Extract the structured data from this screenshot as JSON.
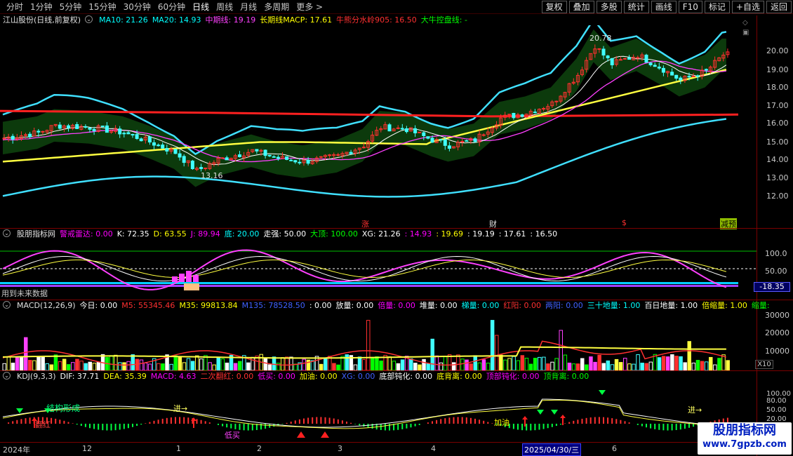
{
  "toolbar": {
    "periods": [
      "分时",
      "1分钟",
      "5分钟",
      "15分钟",
      "30分钟",
      "60分钟",
      "日线",
      "周线",
      "月线",
      "多周期",
      "更多 >"
    ],
    "right_buttons": [
      "复权",
      "叠加",
      "多股",
      "统计",
      "画线",
      "F10",
      "标记",
      "+自选",
      "返回"
    ]
  },
  "main": {
    "title": "江山股份(日线,前复权)",
    "ma10": "MA10: 21.26",
    "ma20": "MA20: 14.93",
    "mid": "中期线: 19.19",
    "long": "长期线MACP: 17.61",
    "bear": "牛熊分水岭905: 16.50",
    "bull": "大牛控盘线: -",
    "high_label": "20.78",
    "low_label": "13.16",
    "y_ticks": [
      "20.00",
      "19.00",
      "18.00",
      "17.00",
      "16.00",
      "15.00",
      "14.00",
      "13.00",
      "12.00"
    ],
    "markers": [
      "涨",
      "财",
      "$",
      "减预"
    ]
  },
  "ind1": {
    "title": "股朋指标网",
    "items": [
      {
        "t": "警戒雷达: 0.00",
        "c": "#ff00ff"
      },
      {
        "t": "K: 72.35",
        "c": "#ffffff"
      },
      {
        "t": "D: 63.55",
        "c": "#ffff00"
      },
      {
        "t": "J: 89.94",
        "c": "#ff00ff"
      },
      {
        "t": "底: 20.00",
        "c": "#00ffff"
      },
      {
        "t": "走强: 50.00",
        "c": "#ffffff"
      },
      {
        "t": "大顶: 100.00",
        "c": "#00ff00"
      },
      {
        "t": "XG: 21.26",
        "c": "#ffffff"
      },
      {
        "t": ": 14.93",
        "c": "#ff00ff"
      },
      {
        "t": ": 19.69",
        "c": "#ffff00"
      },
      {
        "t": ": 19.19",
        "c": "#ffffff"
      },
      {
        "t": ": 17.61",
        "c": "#ffffff"
      },
      {
        "t": ": 16.50",
        "c": "#ffffff"
      }
    ],
    "note": "用到未来数据",
    "y_ticks": [
      "100.0",
      "50.00"
    ],
    "value_box": "-18.35"
  },
  "ind2": {
    "title": "MACD(12,26,9)",
    "items": [
      {
        "t": "今日: 0.00",
        "c": "#ffffff"
      },
      {
        "t": "M5: 55345.46",
        "c": "#ff3030"
      },
      {
        "t": "M35: 99813.84",
        "c": "#ffff00"
      },
      {
        "t": "M135: 78528.50",
        "c": "#4060ff"
      },
      {
        "t": ": 0.00",
        "c": "#ffffff"
      },
      {
        "t": "放量: 0.00",
        "c": "#ffffff"
      },
      {
        "t": "倍量: 0.00",
        "c": "#ff00ff"
      },
      {
        "t": "堆量: 0.00",
        "c": "#ffffff"
      },
      {
        "t": "梯量: 0.00",
        "c": "#00ffff"
      },
      {
        "t": "红阳: 0.00",
        "c": "#ff3030"
      },
      {
        "t": "两阳: 0.00",
        "c": "#4060ff"
      },
      {
        "t": "三十地量: 1.00",
        "c": "#00ffff"
      },
      {
        "t": "百日地量: 1.00",
        "c": "#ffffff"
      },
      {
        "t": "倍缩量: 1.00",
        "c": "#ffff00"
      },
      {
        "t": "缩量:",
        "c": "#00ff00"
      }
    ],
    "y_ticks": [
      "30000",
      "20000",
      "10000"
    ],
    "unit": "X10"
  },
  "ind3": {
    "title": "KDJ(9,3,3)",
    "items": [
      {
        "t": "DIF: 37.71",
        "c": "#ffffff"
      },
      {
        "t": "DEA: 35.39",
        "c": "#ffff00"
      },
      {
        "t": "MACD: 4.63",
        "c": "#ff00ff"
      },
      {
        "t": "二次翻红: 0.00",
        "c": "#ff3030"
      },
      {
        "t": "低买: 0.00",
        "c": "#ff00ff"
      },
      {
        "t": "加油: 0.00",
        "c": "#ffff00"
      },
      {
        "t": "XG: 0.00",
        "c": "#4060ff"
      },
      {
        "t": "底部钝化: 0.00",
        "c": "#ffffff"
      },
      {
        "t": "底背离: 0.00",
        "c": "#ffff00"
      },
      {
        "t": "顶部钝化: 0.00",
        "c": "#ff00ff"
      },
      {
        "t": "顶背离: 0.00",
        "c": "#00ff00"
      }
    ],
    "y_ticks": [
      "100.00",
      "80.00",
      "50.00",
      "20.00",
      "0.00"
    ],
    "labels": {
      "jgxc": "结构形成",
      "jin1": "进→",
      "jin2": "进→",
      "fan": "翻红",
      "dimai": "低买",
      "jiayou": "加油"
    }
  },
  "xaxis": {
    "labels": [
      "2024年",
      "12",
      "1",
      "2",
      "3",
      "4",
      "2025/04/30/三",
      "6"
    ]
  },
  "watermark": {
    "name": "股朋指标网",
    "url": "www.7gpzb.com"
  }
}
